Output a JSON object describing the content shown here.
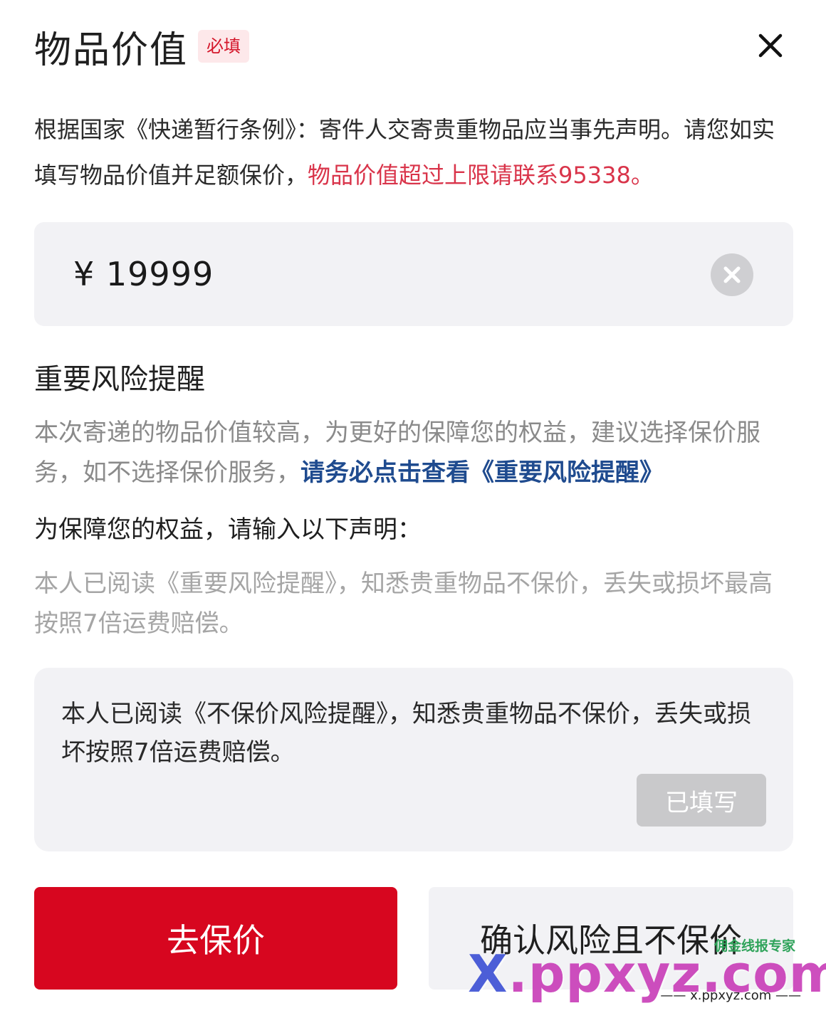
{
  "header": {
    "title": "物品价值",
    "required_badge": "必填"
  },
  "notice": {
    "text": "根据国家《快递暂行条例》：寄件人交寄贵重物品应当事先声明。请您如实填写物品价值并足额保价，",
    "highlight": "物品价值超过上限请联系95338。"
  },
  "value_input": {
    "value": "¥ 19999"
  },
  "risk": {
    "title": "重要风险提醒",
    "desc": "本次寄递的物品价值较高，为更好的保障您的权益，建议选择保价服务，如不选择保价服务，",
    "link": "请务必点击查看《重要风险提醒》"
  },
  "declaration": {
    "prompt": "为保障您的权益，请输入以下声明：",
    "template": "本人已阅读《重要风险提醒》，知悉贵重物品不保价，丢失或损坏最高按照7倍运费赔偿。",
    "input_text": "本人已阅读《不保价风险提醒》，知悉贵重物品不保价，丢失或损坏按照7倍运费赔偿。",
    "filled_label": "已填写"
  },
  "actions": {
    "insure_label": "去保价",
    "no_insure_label": "确认风险且不保价"
  },
  "watermark": {
    "brand": "佣金线报专家",
    "domain_x": "X",
    "domain_rest": ".ppxyz.com",
    "small": "—— x.ppxyz.com ——"
  },
  "colors": {
    "accent_red": "#d7061f",
    "highlight_red": "#d9344a",
    "link_blue": "#1f4b8f"
  }
}
